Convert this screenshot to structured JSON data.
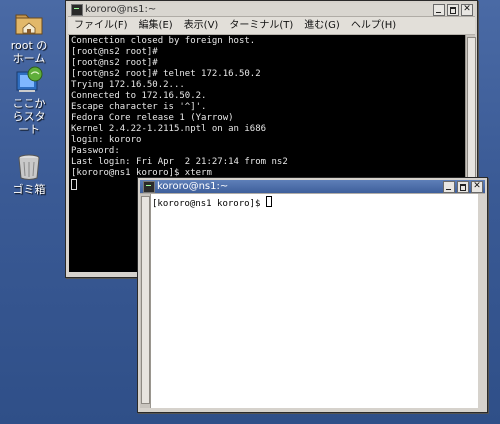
{
  "desktop_icons": [
    {
      "label": "root の\nホーム",
      "icon": "home-folder-icon"
    },
    {
      "label": "ここか\nらスタ\nート",
      "icon": "start-here-icon"
    },
    {
      "label": "ゴミ箱",
      "icon": "trash-icon"
    }
  ],
  "window1": {
    "title": "kororo@ns1:~",
    "menu": [
      "ファイル(F)",
      "編集(E)",
      "表示(V)",
      "ターミナル(T)",
      "進む(G)",
      "ヘルプ(H)"
    ],
    "lines": [
      "Connection closed by foreign host.",
      "[root@ns2 root]#",
      "[root@ns2 root]#",
      "[root@ns2 root]# telnet 172.16.50.2",
      "Trying 172.16.50.2...",
      "Connected to 172.16.50.2.",
      "Escape character is '^]'.",
      "Fedora Core release 1 (Yarrow)",
      "Kernel 2.4.22-1.2115.nptl on an i686",
      "login: kororo",
      "Password:",
      "Last login: Fri Apr  2 21:27:14 from ns2",
      "[kororo@ns1 kororo]$ xterm"
    ]
  },
  "window2": {
    "title": "kororo@ns1:~",
    "prompt": "[kororo@ns1 kororo]$ "
  },
  "colors": {
    "desktop": "#3f5f99",
    "terminal_bg": "#000000",
    "xterm_bg": "#ffffff",
    "active_title": "#4a6ba8"
  }
}
